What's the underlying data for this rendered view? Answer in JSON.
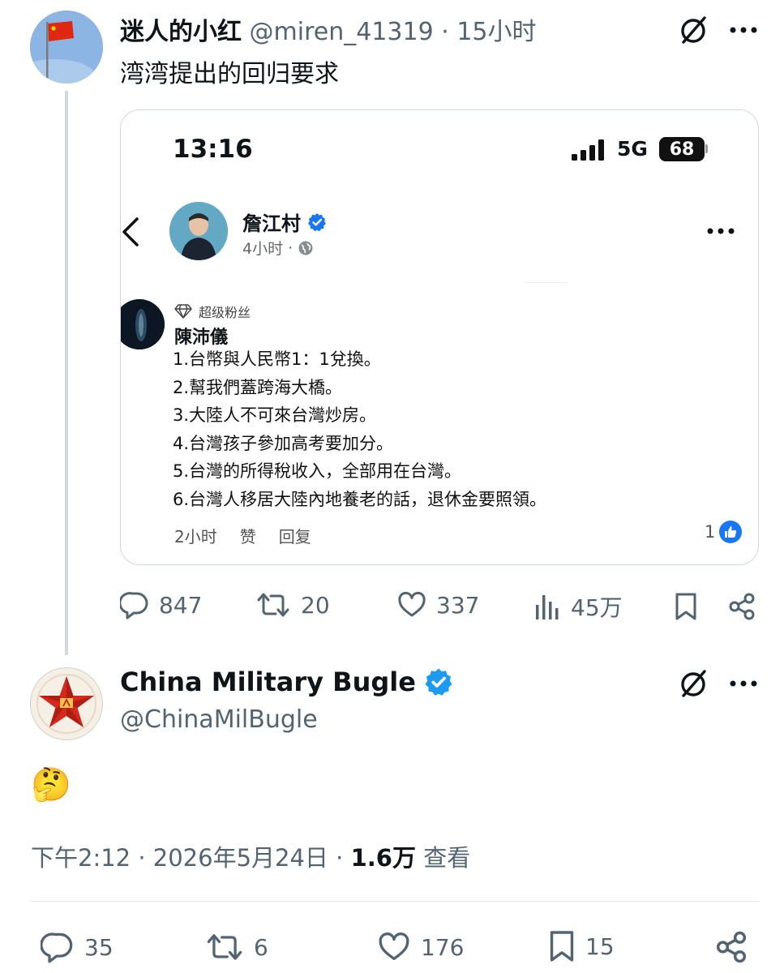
{
  "tweet1": {
    "display_name": "迷人的小红",
    "handle": "@miren_41319",
    "separator": "·",
    "time_ago": "15小时",
    "text": "湾湾提出的回归要求",
    "stats": {
      "replies": "847",
      "retweets": "20",
      "likes": "337",
      "views": "45万"
    }
  },
  "embedded_screenshot": {
    "status_time": "13:16",
    "network": "5G",
    "battery": "68",
    "poster_name": "詹江村",
    "poster_time": "4小时",
    "poster_time_sep": "·",
    "badge_label": "超级粉丝",
    "commenter_name": "陳沛儀",
    "comment_lines": [
      "1.台幣與人民幣1：1兌換。",
      "2.幫我們蓋跨海大橋。",
      "3.大陸人不可來台灣炒房。",
      "4.台灣孩子參加高考要加分。",
      "5.台灣的所得稅收入，全部用在台灣。",
      "6.台灣人移居大陸內地養老的話，退休金要照領。"
    ],
    "comment_time": "2小时",
    "like_action": "赞",
    "reply_action": "回复",
    "like_count": "1"
  },
  "tweet2": {
    "display_name": "China Military Bugle",
    "handle": "@ChinaMilBugle",
    "body_emoji": "🤔",
    "timestamp": "下午2:12 · 2026年5月24日 ·",
    "view_count": "1.6万",
    "views_label": "查看",
    "stats": {
      "replies": "35",
      "retweets": "6",
      "likes": "176",
      "bookmarks": "15"
    }
  },
  "colors": {
    "verified_blue": "#1d9bf0",
    "text_gray": "#536471",
    "thread_line": "#cfd9de"
  }
}
